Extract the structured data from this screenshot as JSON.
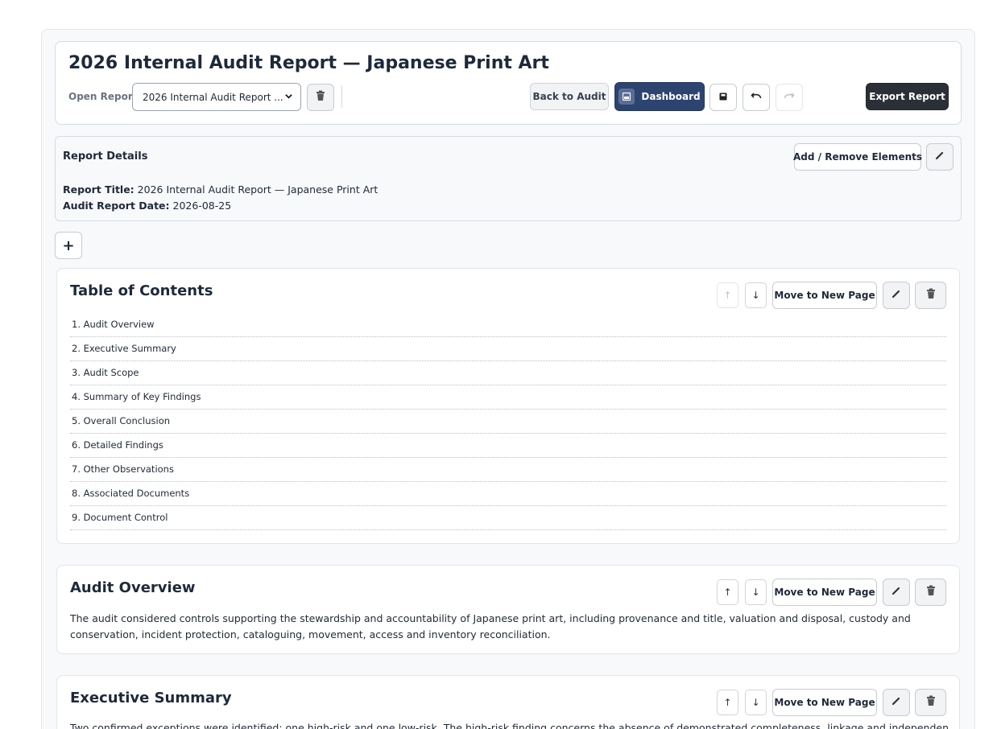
{
  "header": {
    "title": "2026 Internal Audit Report — Japanese Print Art",
    "open_report_label": "Open Report",
    "selected_report": "2026 Internal Audit Report ...",
    "back_to_audit": "Back to Audit",
    "dashboard": "Dashboard",
    "export_report": "Export Report"
  },
  "details": {
    "title": "Report Details",
    "add_remove": "Add / Remove Elements",
    "report_title_label": "Report Title:",
    "report_title_value": "2026 Internal Audit Report — Japanese Print Art",
    "date_label": "Audit Report Date:",
    "date_value": "2026-08-25"
  },
  "add_section_symbol": "+",
  "section_actions": {
    "move_to_new_page": "Move to New Page",
    "up": "↑",
    "down": "↓"
  },
  "toc": {
    "title": "Table of Contents",
    "items": [
      "1. Audit Overview",
      "2. Executive Summary",
      "3. Audit Scope",
      "4. Summary of Key Findings",
      "5. Overall Conclusion",
      "6. Detailed Findings",
      "7. Other Observations",
      "8. Associated Documents",
      "9. Document Control"
    ]
  },
  "audit_overview": {
    "title": "Audit Overview",
    "text": "The audit considered controls supporting the stewardship and accountability of Japanese print art, including provenance and title, valuation and disposal, custody and conservation, incident protection, cataloguing, movement, access and inventory reconciliation."
  },
  "executive_summary": {
    "title": "Executive Summary",
    "text": "Two confirmed exceptions were identified: one high-risk and one low-risk. The high-risk finding concerns the absence of demonstrated completeness, linkage and independent review of"
  },
  "icons": {
    "trash": "trash-icon",
    "pencil": "pencil-icon",
    "save": "save-icon",
    "undo": "undo-icon",
    "redo": "redo-icon",
    "dashboard": "dashboard-icon"
  }
}
